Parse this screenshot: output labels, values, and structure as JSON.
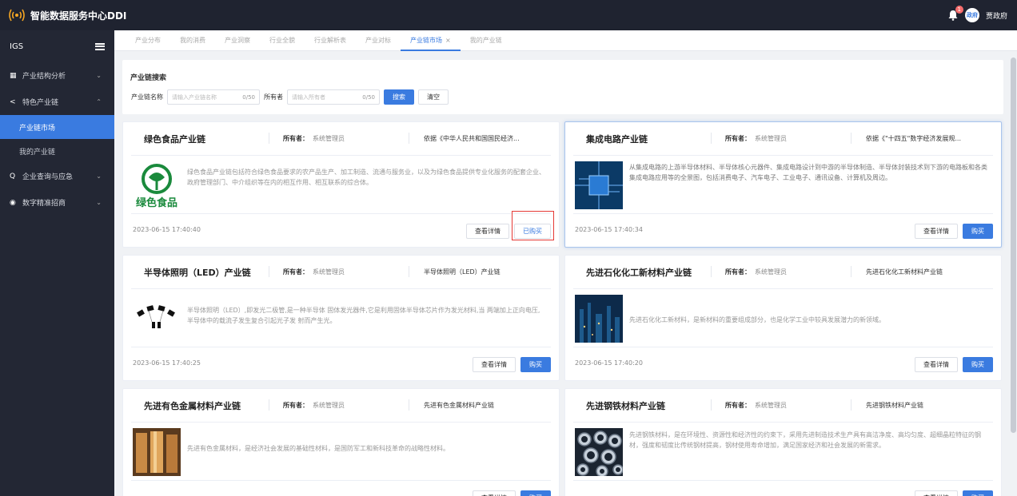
{
  "app": {
    "title": "智能数据服务中心DDI",
    "notification_count": "1",
    "avatar_text": "政府",
    "username": "贾政府"
  },
  "sidebar": {
    "header": "IGS",
    "menus": [
      {
        "label": "产业结构分析",
        "icon": "chart-icon"
      },
      {
        "label": "特色产业链",
        "icon": "share-icon"
      },
      {
        "label": "企业查询与应急",
        "icon": "search-icon"
      },
      {
        "label": "数字精准招商",
        "icon": "target-icon"
      }
    ],
    "sub_items": [
      "产业链市场",
      "我的产业链"
    ]
  },
  "tabs": [
    "产业分布",
    "我的消费",
    "产业洞察",
    "行业全貌",
    "行业解析表",
    "产业对标",
    "产业链市场",
    "我的产业链"
  ],
  "search": {
    "title": "产业链搜索",
    "name_label": "产业链名称",
    "name_placeholder": "请输入产业链名称",
    "name_count": "0/50",
    "owner_label": "所有者",
    "owner_placeholder": "请输入所有者",
    "owner_count": "0/50",
    "search_button": "搜索",
    "clear_button": "清空"
  },
  "owner_label": "所有者：",
  "detail_button": "查看详情",
  "buy_button": "购买",
  "bought_button": "已购买",
  "cards": [
    {
      "title": "绿色食品产业链",
      "owner": "系统管理员",
      "basis": "依据《中华人民共和国国民经济...",
      "desc": "绿色食品产业链包括符合绿色食品要求的农产品生产、加工制造、流通与服务业，以及为绿色食品提供专业化服务的配套企业、政府管理部门、中介组织等在内的相互作用、相互联系的综合体。",
      "time": "2023-06-15 17:40:40",
      "image_label": "绿色食品",
      "bought": true
    },
    {
      "title": "集成电路产业链",
      "owner": "系统管理员",
      "basis": "依据《\"十四五\"数字经济发展规...",
      "desc": "从集成电路的上游半导体材料、半导体核心元器件、集成电路设计到中游的半导体制造、半导体封装技术到下游的电路板和各类集成电路应用等的全景图，包括消费电子、汽车电子、工业电子、通讯设备、计算机及周边。",
      "time": "2023-06-15 17:40:34",
      "bought": false
    },
    {
      "title": "半导体照明（LED）产业链",
      "owner": "系统管理员",
      "basis": "半导体照明（LED）产业链",
      "desc": "半导体照明（LED）,即发光二极管,是一种半导体 固体发光器件,它是利用固体半导体芯片作为发光材料,当 两端加上正向电压,半导体中的载流子发生复合引起光子发 射而产生光。",
      "time": "2023-06-15 17:40:25",
      "bought": false
    },
    {
      "title": "先进石化化工新材料产业链",
      "owner": "系统管理员",
      "basis": "先进石化化工新材料产业链",
      "desc": "先进石化化工新材料，是新材料的重要组成部分，也是化学工业中较具发展潜力的新领域。",
      "time": "2023-06-15 17:40:20",
      "bought": false
    },
    {
      "title": "先进有色金属材料产业链",
      "owner": "系统管理员",
      "basis": "先进有色金属材料产业链",
      "desc": "先进有色金属材料，是经济社会发展的基础性材料，是国防军工和新科技革命的战略性材料。",
      "time": "",
      "bought": false
    },
    {
      "title": "先进钢铁材料产业链",
      "owner": "系统管理员",
      "basis": "先进钢铁材料产业链",
      "desc": "先进钢铁材料，是在环境性、资源性和经济性的约束下，采用先进制造技术生产具有高洁净度、高均匀度、超细晶粒特征的钢材，强度和韧度比传统钢材提高，钢材使用寿命增加，满足国家经济和社会发展的新需求。",
      "time": "",
      "bought": false
    }
  ],
  "colors": {
    "accent": "#3a7be0",
    "topbar": "#1f2330",
    "sidebar": "#232734",
    "highlight_box": "#e53935",
    "logo_green": "#1a8a3c"
  }
}
